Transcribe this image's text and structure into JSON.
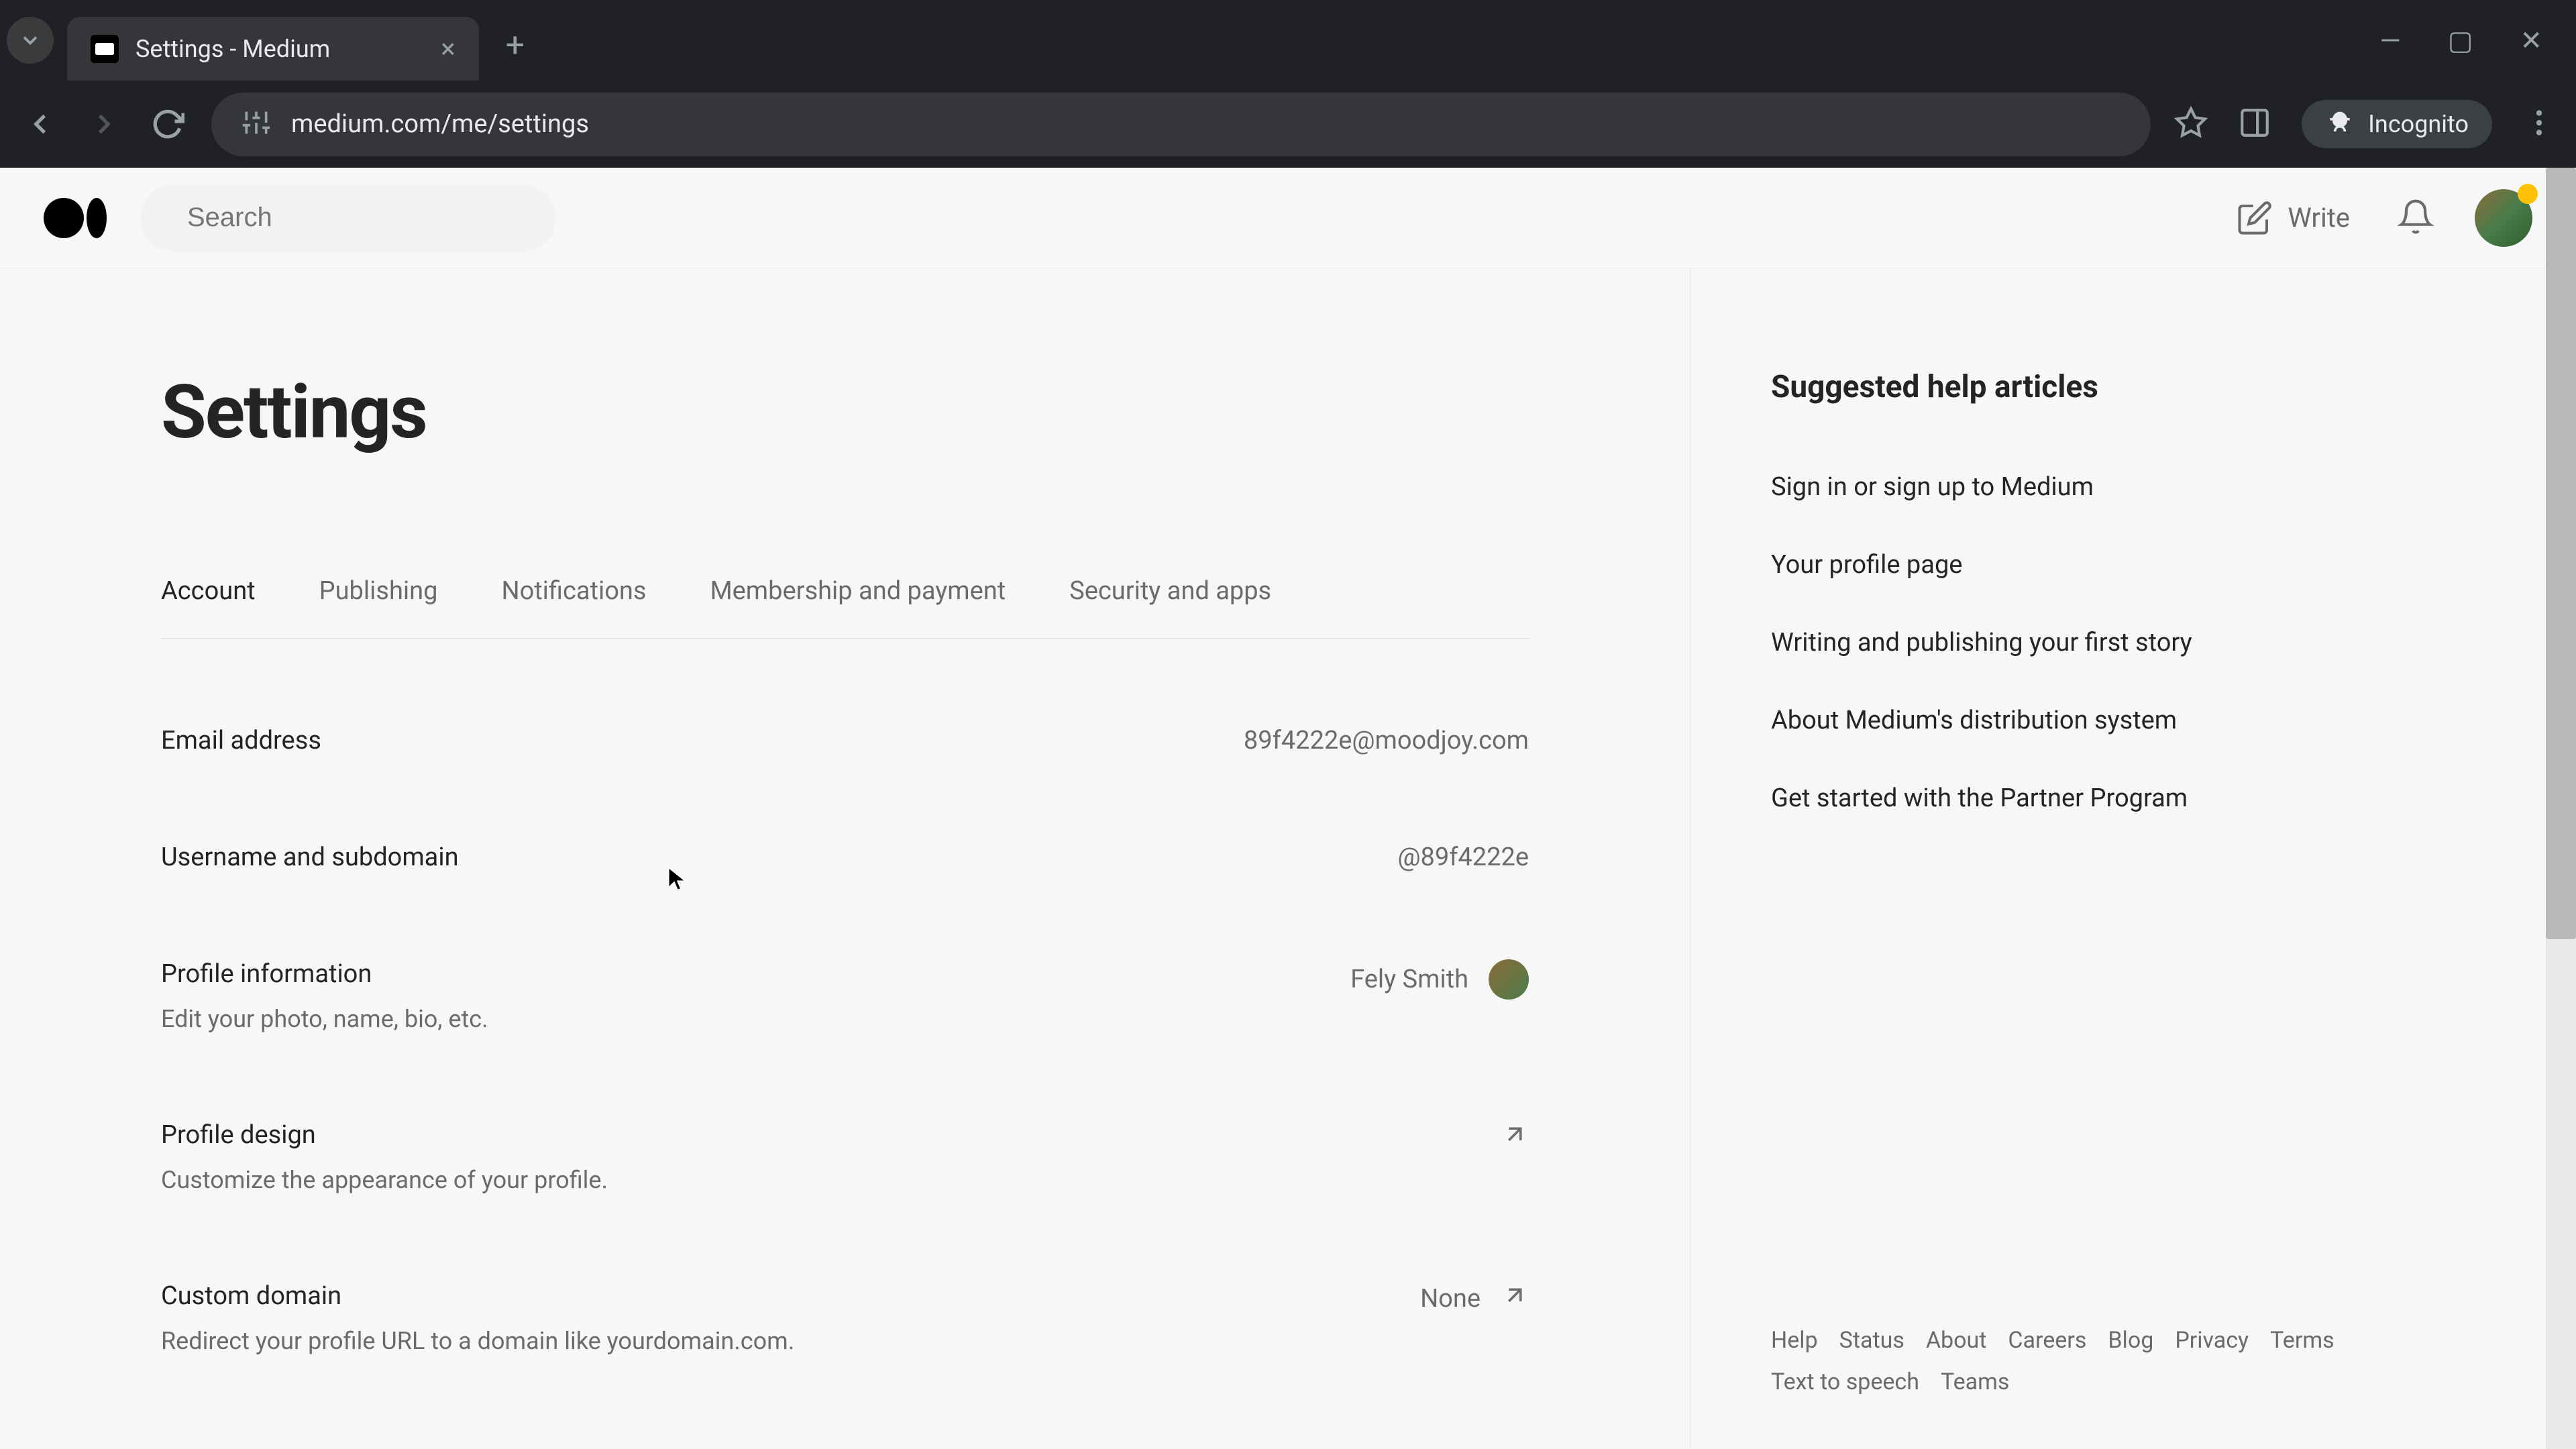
{
  "browser": {
    "tab_title": "Settings - Medium",
    "url": "medium.com/me/settings",
    "incognito_label": "Incognito"
  },
  "header": {
    "search_placeholder": "Search",
    "write_label": "Write"
  },
  "page": {
    "title": "Settings"
  },
  "tabs": [
    {
      "label": "Account",
      "active": true
    },
    {
      "label": "Publishing",
      "active": false
    },
    {
      "label": "Notifications",
      "active": false
    },
    {
      "label": "Membership and payment",
      "active": false
    },
    {
      "label": "Security and apps",
      "active": false
    }
  ],
  "settings": {
    "email": {
      "label": "Email address",
      "value": "89f4222e@moodjoy.com"
    },
    "username": {
      "label": "Username and subdomain",
      "value": "@89f4222e"
    },
    "profile_info": {
      "label": "Profile information",
      "desc": "Edit your photo, name, bio, etc.",
      "value": "Fely Smith"
    },
    "profile_design": {
      "label": "Profile design",
      "desc": "Customize the appearance of your profile."
    },
    "custom_domain": {
      "label": "Custom domain",
      "desc": "Redirect your profile URL to a domain like yourdomain.com.",
      "value": "None"
    }
  },
  "sidebar": {
    "title": "Suggested help articles",
    "links": [
      "Sign in or sign up to Medium",
      "Your profile page",
      "Writing and publishing your first story",
      "About Medium's distribution system",
      "Get started with the Partner Program"
    ]
  },
  "footer": [
    "Help",
    "Status",
    "About",
    "Careers",
    "Blog",
    "Privacy",
    "Terms",
    "Text to speech",
    "Teams"
  ]
}
